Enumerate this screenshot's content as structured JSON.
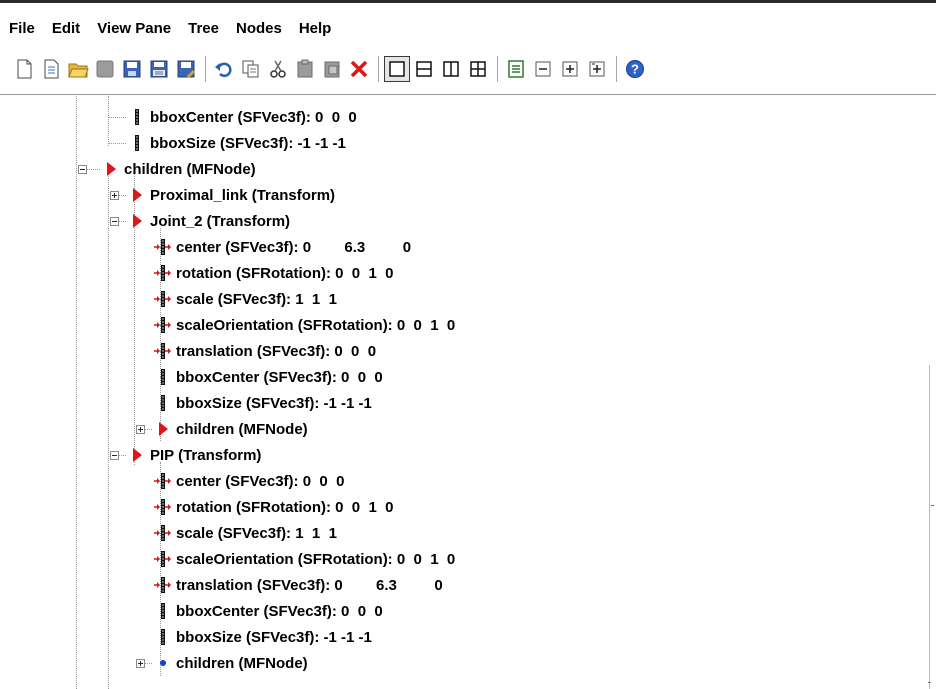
{
  "menubar": {
    "items": [
      "File",
      "Edit",
      "View Pane",
      "Tree",
      "Nodes",
      "Help"
    ]
  },
  "toolbar": {
    "buttons": [
      "new-document-icon",
      "new-from-template-icon",
      "open-folder-icon",
      "disabled-tool-icon",
      "save-icon",
      "save-all-icon",
      "save-as-icon",
      "undo-icon",
      "copy-icon",
      "cut-icon",
      "paste-icon",
      "paste-special-icon",
      "delete-icon",
      "single-pane-icon",
      "split-horizontal-icon",
      "split-vertical-icon",
      "four-pane-icon",
      "list-view-icon",
      "collapse-all-icon",
      "expand-all-icon",
      "expand-node-icon",
      "help-icon"
    ]
  },
  "tree": {
    "rows": [
      {
        "text": "bboxCenter (SFVec3f): 0  0  0",
        "icon": "field-icon"
      },
      {
        "text": "bboxSize (SFVec3f): -1 -1 -1",
        "icon": "field-icon"
      },
      {
        "text": "children (MFNode)",
        "icon": "node-arrow-icon",
        "expander": "minus"
      },
      {
        "text": "Proximal_link (Transform)",
        "icon": "node-arrow-icon",
        "expander": "plus"
      },
      {
        "text": "Joint_2 (Transform)",
        "icon": "node-arrow-icon",
        "expander": "minus"
      },
      {
        "text": "center (SFVec3f): 0        6.3         0",
        "icon": "route-field-icon"
      },
      {
        "text": "rotation (SFRotation): 0  0  1  0",
        "icon": "route-field-icon"
      },
      {
        "text": "scale (SFVec3f): 1  1  1",
        "icon": "route-field-icon"
      },
      {
        "text": "scaleOrientation (SFRotation): 0  0  1  0",
        "icon": "route-field-icon"
      },
      {
        "text": "translation (SFVec3f): 0  0  0",
        "icon": "route-field-icon"
      },
      {
        "text": "bboxCenter (SFVec3f): 0  0  0",
        "icon": "field-icon"
      },
      {
        "text": "bboxSize (SFVec3f): -1 -1 -1",
        "icon": "field-icon"
      },
      {
        "text": "children (MFNode)",
        "icon": "node-arrow-icon",
        "expander": "plus"
      },
      {
        "text": "PIP (Transform)",
        "icon": "node-arrow-icon",
        "expander": "minus"
      },
      {
        "text": "center (SFVec3f): 0  0  0",
        "icon": "route-field-icon"
      },
      {
        "text": "rotation (SFRotation): 0  0  1  0",
        "icon": "route-field-icon"
      },
      {
        "text": "scale (SFVec3f): 1  1  1",
        "icon": "route-field-icon"
      },
      {
        "text": "scaleOrientation (SFRotation): 0  0  1  0",
        "icon": "route-field-icon"
      },
      {
        "text": "translation (SFVec3f): 0        6.3         0",
        "icon": "route-field-icon"
      },
      {
        "text": "bboxCenter (SFVec3f): 0  0  0",
        "icon": "field-icon"
      },
      {
        "text": "bboxSize (SFVec3f): -1 -1 -1",
        "icon": "field-icon"
      },
      {
        "text": "children (MFNode)",
        "icon": "empty-node-dot-icon",
        "expander": "plus"
      }
    ]
  },
  "colors": {
    "node_arrow": "#e0151b",
    "route_red": "#d01818",
    "dot_blue": "#1a3fd0"
  }
}
